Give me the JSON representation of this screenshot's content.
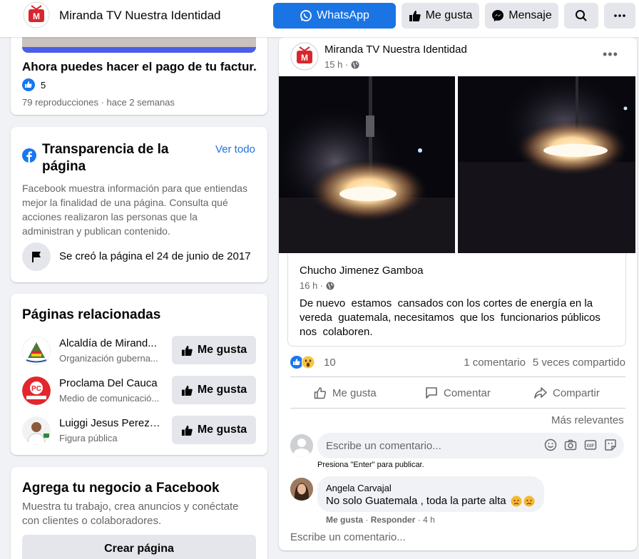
{
  "header": {
    "page_name": "Miranda TV Nuestra Identidad",
    "whatsapp_label": "WhatsApp",
    "like_label": "Me gusta",
    "message_label": "Mensaje"
  },
  "video": {
    "title": "Ahora puedes hacer el pago de tu factur...",
    "like_count": "5",
    "meta": "79 reproducciones · hace 2 semanas"
  },
  "transparency": {
    "title": "Transparencia de la página",
    "see_all": "Ver todo",
    "description": "Facebook muestra información para que entiendas mejor la finalidad de una página. Consulta qué acciones realizaron las personas que la administran y publican contenido.",
    "created": "Se creó la página el 24 de junio de 2017"
  },
  "related": {
    "title": "Páginas relacionadas",
    "button_label": "Me gusta",
    "items": [
      {
        "name": "Alcaldía de Mirand...",
        "category": "Organización guberna..."
      },
      {
        "name": "Proclama Del Cauca",
        "category": "Medio de comunicació..."
      },
      {
        "name": "Luiggi Jesus Perez ...",
        "category": "Figura pública"
      }
    ]
  },
  "business": {
    "title": "Agrega tu negocio a Facebook",
    "description": "Muestra tu trabajo, crea anuncios y conéctate con clientes o colaboradores.",
    "button_label": "Crear página"
  },
  "post": {
    "author": "Miranda TV Nuestra Identidad",
    "time": "15 h ·",
    "shared": {
      "author": "Chucho Jimenez Gamboa",
      "time": "16 h ·",
      "text": "De nuevo  estamos  cansados con los cortes de energía en la vereda  guatemala, necesitamos  que los  funcionarios públicos nos  colaboren."
    },
    "reaction_count": "10",
    "comments_count": "1 comentario",
    "shares_count": "5 veces compartido",
    "actions": {
      "like": "Me gusta",
      "comment": "Comentar",
      "share": "Compartir"
    },
    "sort_label": "Más relevantes",
    "comment_placeholder": "Escribe un comentario...",
    "enter_hint": "Presiona \"Enter\" para publicar.",
    "comment": {
      "author": "Angela Carvajal",
      "text": "No solo Guatemala , toda la parte alta",
      "like_action": "Me gusta",
      "reply_action": "Responder",
      "time": "4 h"
    },
    "write_more_placeholder": "Escribe un comentario..."
  },
  "colors": {
    "whatsapp_button": "#1b74e4",
    "link": "#216fdb",
    "background": "#f0f2f5"
  },
  "icons": [
    "whatsapp-icon",
    "thumbs-up-icon",
    "messenger-icon",
    "search-icon",
    "more-icon",
    "globe-icon",
    "flag-icon",
    "facebook-icon",
    "comment-icon",
    "share-icon"
  ]
}
